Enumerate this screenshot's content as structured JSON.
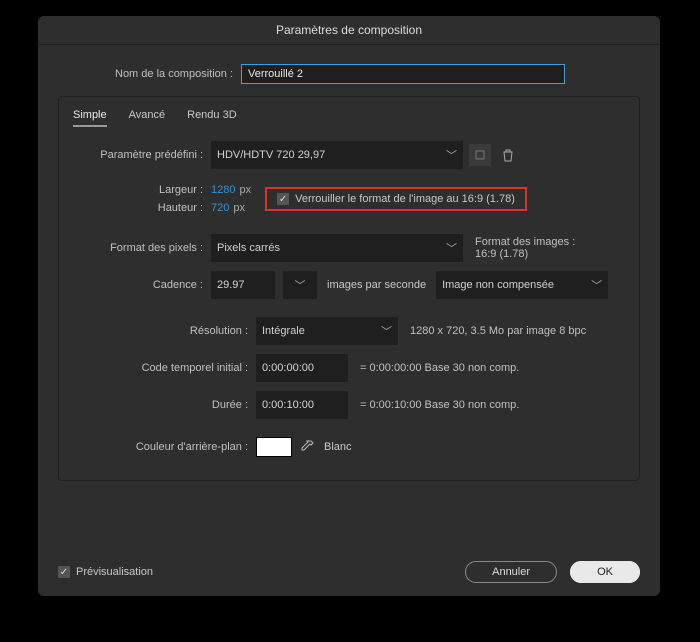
{
  "window": {
    "title": "Paramètres de composition"
  },
  "compName": {
    "label": "Nom de la composition :",
    "value": "Verrouillé 2"
  },
  "tabs": {
    "simple": "Simple",
    "advanced": "Avancé",
    "render3d": "Rendu 3D"
  },
  "preset": {
    "label": "Paramètre prédéfini :",
    "value": "HDV/HDTV 720 29,97",
    "saveIcon": "save-preset-icon",
    "deleteIcon": "delete-preset-icon"
  },
  "dimensions": {
    "widthLabel": "Largeur :",
    "widthValue": "1280",
    "widthUnit": "px",
    "heightLabel": "Hauteur :",
    "heightValue": "720",
    "heightUnit": "px",
    "lockLabel": "Verrouiller le format de l'image au 16:9 (1.78)"
  },
  "pixelFormat": {
    "label": "Format des pixels :",
    "value": "Pixels carrés",
    "asideLabel": "Format des images :",
    "asideValue": "16:9 (1.78)"
  },
  "cadence": {
    "label": "Cadence :",
    "value": "29.97",
    "unitsLabel": "images par seconde",
    "modeValue": "Image non compensée"
  },
  "resolution": {
    "label": "Résolution :",
    "value": "Intégrale",
    "info": "1280 x 720, 3.5 Mo par image 8 bpc"
  },
  "startTC": {
    "label": "Code temporel initial :",
    "value": "0:00:00:00",
    "info": "= 0:00:00:00  Base 30  non comp."
  },
  "duration": {
    "label": "Durée :",
    "value": "0:00:10:00",
    "info": "= 0:00:10:00  Base 30  non comp."
  },
  "bg": {
    "label": "Couleur d'arrière-plan :",
    "hex": "#ffffff",
    "name": "Blanc"
  },
  "footer": {
    "preview": "Prévisualisation",
    "cancel": "Annuler",
    "ok": "OK"
  }
}
